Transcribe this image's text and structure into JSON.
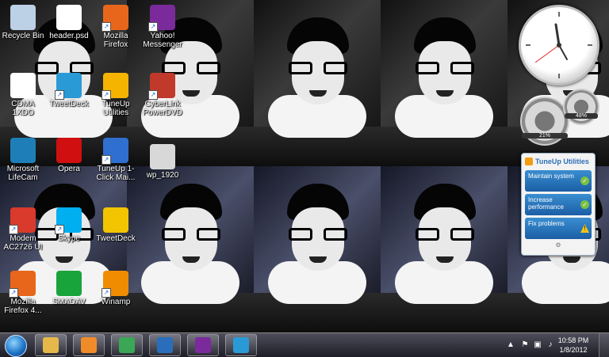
{
  "desktop_icons": [
    {
      "label": "Recycle Bin",
      "icon": "recycle-bin-icon",
      "color": "#bcd0e6"
    },
    {
      "label": "header.psd",
      "icon": "document-icon",
      "color": "#ffffff"
    },
    {
      "label": "Mozilla Firefox",
      "icon": "firefox-icon",
      "color": "#e8661b"
    },
    {
      "label": "Yahoo! Messenger",
      "icon": "yahoo-messenger-icon",
      "color": "#7b2a9b"
    },
    {
      "label": "CDMA 1XDO",
      "icon": "cdma-icon",
      "color": "#ffffff"
    },
    {
      "label": "TweetDeck",
      "icon": "tweetdeck-icon",
      "color": "#2a9ad6"
    },
    {
      "label": "TuneUp Utilities",
      "icon": "tuneup-icon",
      "color": "#f4b400"
    },
    {
      "label": "CyberLink PowerDVD",
      "icon": "powerdvd-icon",
      "color": "#c0392b"
    },
    {
      "label": "Microsoft LifeCam",
      "icon": "lifecam-icon",
      "color": "#1e7fb8"
    },
    {
      "label": "Opera",
      "icon": "opera-icon",
      "color": "#d01010"
    },
    {
      "label": "TuneUp 1-Click Mai...",
      "icon": "tuneup-1click-icon",
      "color": "#2f6fd0"
    },
    {
      "label": "wp_1920",
      "icon": "image-file-icon",
      "color": "#d8d8d8"
    },
    {
      "label": "Modem AC2726 UI",
      "icon": "modem-icon",
      "color": "#d93a2b"
    },
    {
      "label": "Skype",
      "icon": "skype-icon",
      "color": "#00aff0"
    },
    {
      "label": "TweetDeck",
      "icon": "tweetdeck-bird-icon",
      "color": "#f2c500"
    },
    {
      "label": "Mozilla Firefox 4...",
      "icon": "firefox-icon",
      "color": "#e8661b"
    },
    {
      "label": "SMADAV",
      "icon": "smadav-icon",
      "color": "#19a33b"
    },
    {
      "label": "Winamp",
      "icon": "winamp-icon",
      "color": "#f08c00"
    }
  ],
  "gadgets": {
    "meters": {
      "cpu": "21%",
      "memory": "48%"
    },
    "tuneup": {
      "title": "TuneUp Utilities",
      "buttons": [
        {
          "label": "Maintain system",
          "status": "ok"
        },
        {
          "label": "Increase performance",
          "status": "ok"
        },
        {
          "label": "Fix problems",
          "status": "warn"
        }
      ]
    }
  },
  "taskbar": {
    "pinned": [
      {
        "name": "windows-explorer",
        "icon": "folder-icon",
        "color": "#e6b84a"
      },
      {
        "name": "media-player",
        "icon": "media-player-icon",
        "color": "#f08b2a"
      },
      {
        "name": "chrome",
        "icon": "chrome-icon",
        "color": "#3aa757"
      },
      {
        "name": "photoshop",
        "icon": "photoshop-icon",
        "color": "#2a6ebb"
      },
      {
        "name": "yahoo-messenger",
        "icon": "yahoo-messenger-icon",
        "color": "#7b2a9b"
      },
      {
        "name": "tweetdeck",
        "icon": "twitter-bird-icon",
        "color": "#2a9ad6"
      }
    ],
    "clock": {
      "time": "10:58 PM",
      "date": "1/8/2012"
    }
  }
}
